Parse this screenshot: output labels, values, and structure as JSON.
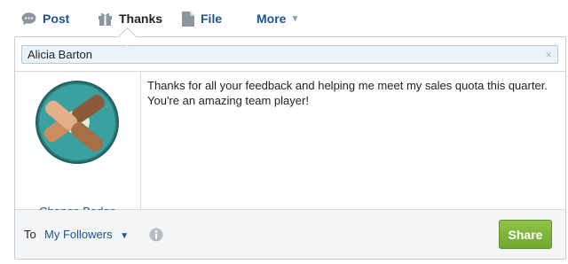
{
  "publisher": {
    "tabs": [
      {
        "label": "Post",
        "icon": "speech-bubble-icon"
      },
      {
        "label": "Thanks",
        "icon": "gift-icon"
      },
      {
        "label": "File",
        "icon": "file-icon"
      },
      {
        "label": "More",
        "icon": "chevron-down-icon"
      }
    ],
    "active_tab": "Thanks"
  },
  "thanks": {
    "recipient": "Alicia Barton",
    "clear_glyph": "×",
    "badge_link": "Change Badge",
    "message": "Thanks for all your feedback and helping me meet my sales quota this quarter. You're an amazing team player!"
  },
  "footer": {
    "to_label": "To",
    "audience": "My Followers",
    "share_label": "Share"
  },
  "colors": {
    "link": "#1b5297",
    "share_button": "#7ab33a",
    "recipient_bg": "#eaf3f9"
  }
}
